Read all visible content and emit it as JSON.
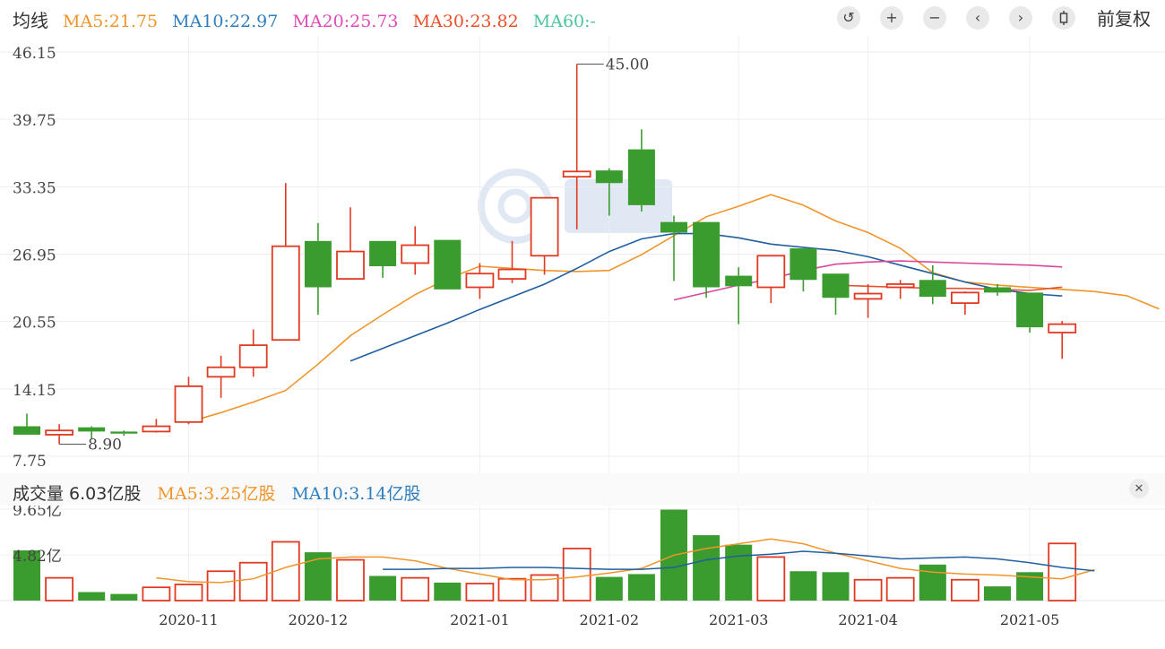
{
  "header": {
    "title": "均线",
    "ma": [
      {
        "label": "MA5:21.75",
        "color": "#f0952a"
      },
      {
        "label": "MA10:22.97",
        "color": "#2f7fc0"
      },
      {
        "label": "MA20:25.73",
        "color": "#e04bb8"
      },
      {
        "label": "MA30:23.82",
        "color": "#e8502a"
      },
      {
        "label": "MA60:-",
        "color": "#4cc59a"
      }
    ],
    "toolbar_icons": [
      "reset-icon",
      "zoom-in-icon",
      "zoom-out-icon",
      "prev-icon",
      "next-icon",
      "candle-icon"
    ],
    "adjust_label": "前复权"
  },
  "volume_header": {
    "title": "成交量 6.03亿股",
    "ma5": "MA5:3.25亿股",
    "ma10": "MA10:3.14亿股",
    "ma5_color": "#f0952a",
    "ma10_color": "#2f7fc0",
    "close_icon": "close-icon"
  },
  "colors": {
    "up": "#e23a22",
    "down": "#3a9b2e"
  },
  "chart_data": {
    "type": "candlestick",
    "y_ticks": [
      "46.15",
      "39.75",
      "33.35",
      "26.95",
      "20.55",
      "14.15",
      "7.75"
    ],
    "ylim": [
      7.75,
      46.15
    ],
    "x_labels": [
      "2020-11",
      "2020-12",
      "2021-01",
      "2021-02",
      "2021-03",
      "2021-04",
      "2021-05"
    ],
    "annotations": [
      {
        "text": "45.00",
        "type": "max",
        "index": 17
      },
      {
        "text": "8.90",
        "type": "min",
        "index": 1
      }
    ],
    "candles": [
      {
        "o": 10.6,
        "c": 9.8,
        "h": 11.8,
        "l": 9.8
      },
      {
        "o": 9.8,
        "c": 10.2,
        "h": 10.8,
        "l": 8.9
      },
      {
        "o": 10.5,
        "c": 10.1,
        "h": 10.6,
        "l": 9.4
      },
      {
        "o": 10.1,
        "c": 9.9,
        "h": 10.2,
        "l": 9.7
      },
      {
        "o": 10.1,
        "c": 10.6,
        "h": 11.3,
        "l": 10.0
      },
      {
        "o": 11.0,
        "c": 14.4,
        "h": 15.3,
        "l": 10.8
      },
      {
        "o": 15.3,
        "c": 16.2,
        "h": 17.3,
        "l": 13.3
      },
      {
        "o": 16.2,
        "c": 18.3,
        "h": 19.8,
        "l": 15.3
      },
      {
        "o": 18.8,
        "c": 27.7,
        "h": 33.7,
        "l": 18.8
      },
      {
        "o": 28.2,
        "c": 23.8,
        "h": 29.9,
        "l": 21.2
      },
      {
        "o": 24.6,
        "c": 27.2,
        "h": 31.4,
        "l": 24.6
      },
      {
        "o": 28.2,
        "c": 25.8,
        "h": 28.2,
        "l": 24.7
      },
      {
        "o": 26.1,
        "c": 27.8,
        "h": 29.6,
        "l": 25.0
      },
      {
        "o": 28.3,
        "c": 23.6,
        "h": 28.3,
        "l": 23.6
      },
      {
        "o": 23.8,
        "c": 25.1,
        "h": 26.1,
        "l": 22.7
      },
      {
        "o": 24.6,
        "c": 25.5,
        "h": 28.2,
        "l": 24.2
      },
      {
        "o": 26.8,
        "c": 32.3,
        "h": 32.3,
        "l": 25.0
      },
      {
        "o": 34.3,
        "c": 34.8,
        "h": 45.0,
        "l": 29.3
      },
      {
        "o": 34.9,
        "c": 33.7,
        "h": 35.1,
        "l": 30.6
      },
      {
        "o": 36.9,
        "c": 31.6,
        "h": 38.8,
        "l": 31.0
      },
      {
        "o": 30.0,
        "c": 29.0,
        "h": 30.6,
        "l": 24.4
      },
      {
        "o": 30.0,
        "c": 23.8,
        "h": 30.0,
        "l": 22.8
      },
      {
        "o": 24.9,
        "c": 23.9,
        "h": 25.7,
        "l": 20.3
      },
      {
        "o": 23.8,
        "c": 26.8,
        "h": 26.8,
        "l": 22.3
      },
      {
        "o": 27.5,
        "c": 24.5,
        "h": 27.5,
        "l": 23.4
      },
      {
        "o": 25.1,
        "c": 22.8,
        "h": 25.1,
        "l": 21.2
      },
      {
        "o": 22.7,
        "c": 23.2,
        "h": 24.1,
        "l": 20.9
      },
      {
        "o": 23.8,
        "c": 24.1,
        "h": 24.5,
        "l": 22.7
      },
      {
        "o": 24.5,
        "c": 22.9,
        "h": 25.9,
        "l": 22.2
      },
      {
        "o": 22.3,
        "c": 23.3,
        "h": 23.4,
        "l": 21.2
      },
      {
        "o": 23.8,
        "c": 23.3,
        "h": 24.1,
        "l": 23.0
      },
      {
        "o": 23.3,
        "c": 20.0,
        "h": 23.3,
        "l": 19.5
      },
      {
        "o": 19.5,
        "c": 20.3,
        "h": 20.6,
        "l": 17.0
      }
    ],
    "ma_series": [
      {
        "name": "MA5",
        "start": 5,
        "values": [
          11.0,
          11.9,
          12.9,
          14.0,
          16.5,
          19.2,
          21.2,
          23.1,
          24.6,
          25.8,
          25.6,
          25.4,
          25.3,
          25.4,
          26.9,
          28.7,
          30.5,
          31.5,
          32.6,
          31.6,
          30.1,
          29.0,
          27.5,
          25.2,
          24.3,
          24.0,
          23.8,
          23.6,
          23.4,
          23.0,
          21.75
        ]
      },
      {
        "name": "MA10",
        "start": 10,
        "values": [
          16.8,
          18.0,
          19.2,
          20.4,
          21.7,
          22.9,
          24.1,
          25.6,
          27.2,
          28.4,
          28.9,
          28.9,
          28.5,
          27.9,
          27.6,
          27.3,
          26.7,
          25.9,
          25.1,
          24.3,
          23.6,
          23.2,
          22.97
        ]
      },
      {
        "name": "MA20",
        "start": 20,
        "values": [
          22.6,
          23.3,
          24.0,
          24.6,
          25.4,
          26.0,
          26.2,
          26.3,
          26.2,
          26.1,
          26.0,
          25.9,
          25.73
        ]
      },
      {
        "name": "MA30",
        "start": 25,
        "values": [
          24.0,
          23.9,
          23.8,
          23.7,
          23.7,
          23.6,
          23.5,
          23.82
        ]
      }
    ],
    "volume": {
      "y_ticks": [
        "9.65亿",
        "4.82亿"
      ],
      "ylim": [
        0,
        9.65
      ],
      "values": [
        5.3,
        2.4,
        0.9,
        0.7,
        1.4,
        1.7,
        3.1,
        4.0,
        6.2,
        5.1,
        4.3,
        2.6,
        2.4,
        1.9,
        1.8,
        2.3,
        2.7,
        5.5,
        2.5,
        2.8,
        9.6,
        6.9,
        5.9,
        4.6,
        3.1,
        3.0,
        2.2,
        2.4,
        3.8,
        2.2,
        1.5,
        3.0,
        6.03
      ],
      "ma5": {
        "start": 4,
        "values": [
          2.4,
          2.0,
          1.9,
          2.3,
          3.5,
          4.4,
          4.6,
          4.6,
          4.2,
          3.4,
          2.8,
          2.2,
          2.2,
          2.5,
          2.9,
          3.4,
          4.8,
          5.5,
          6.0,
          6.5,
          6.0,
          5.0,
          4.2,
          3.4,
          3.0,
          2.8,
          2.7,
          2.5,
          2.3,
          3.25
        ]
      },
      "ma10": {
        "start": 11,
        "values": [
          3.3,
          3.3,
          3.4,
          3.4,
          3.5,
          3.5,
          3.4,
          3.3,
          3.3,
          3.5,
          4.3,
          4.7,
          4.9,
          5.2,
          5.0,
          4.7,
          4.4,
          4.5,
          4.6,
          4.4,
          4.0,
          3.5,
          3.14
        ]
      }
    }
  }
}
